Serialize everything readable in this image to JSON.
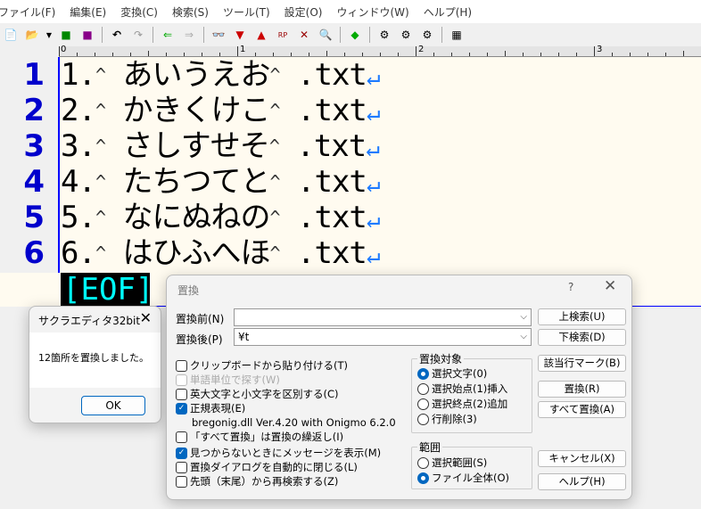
{
  "menu": [
    "ファイル(F)",
    "編集(E)",
    "変換(C)",
    "検索(S)",
    "ツール(T)",
    "設定(O)",
    "ウィンドウ(W)",
    "ヘルプ(H)"
  ],
  "ruler": [
    "0",
    "1",
    "2",
    "3"
  ],
  "editor": {
    "line_numbers": [
      "1",
      "2",
      "3",
      "4",
      "5",
      "6"
    ],
    "lines": [
      {
        "num": "1.",
        "kana": "あいうえお",
        "ext": ".txt"
      },
      {
        "num": "2.",
        "kana": "かきくけこ",
        "ext": ".txt"
      },
      {
        "num": "3.",
        "kana": "さしすせそ",
        "ext": ".txt"
      },
      {
        "num": "4.",
        "kana": "たちつてと",
        "ext": ".txt"
      },
      {
        "num": "5.",
        "kana": "なにぬねの",
        "ext": ".txt"
      },
      {
        "num": "6.",
        "kana": "はひふへほ",
        "ext": ".txt"
      }
    ],
    "caret_mark": "^",
    "return_mark": "↵",
    "eof": "[EOF]"
  },
  "msgbox": {
    "title": "サクラエディタ32bit",
    "message": "12箇所を置換しました。",
    "ok": "OK"
  },
  "replace": {
    "title": "置換",
    "help_q": "?",
    "before_label": "置換前(N)",
    "before_value": "",
    "after_label": "置換後(P)",
    "after_value": "¥t",
    "options": [
      {
        "label": "クリップボードから貼り付ける(T)",
        "checked": false,
        "disabled": false
      },
      {
        "label": "単語単位で探す(W)",
        "checked": false,
        "disabled": true
      },
      {
        "label": "英大文字と小文字を区別する(C)",
        "checked": false,
        "disabled": false
      },
      {
        "label": "正規表現(E)",
        "checked": true,
        "disabled": false
      },
      {
        "label": "「すべて置換」は置換の繰返し(I)",
        "checked": false,
        "disabled": false
      },
      {
        "label": "見つからないときにメッセージを表示(M)",
        "checked": true,
        "disabled": false
      },
      {
        "label": "置換ダイアログを自動的に閉じる(L)",
        "checked": false,
        "disabled": false
      },
      {
        "label": "先頭（末尾）から再検索する(Z)",
        "checked": false,
        "disabled": false
      }
    ],
    "regex_info": "bregonig.dll Ver.4.20 with Onigmo 6.2.0",
    "target_group": {
      "title": "置換対象",
      "options": [
        "選択文字(0)",
        "選択始点(1)挿入",
        "選択終点(2)追加",
        "行削除(3)"
      ],
      "selected": 0
    },
    "range_group": {
      "title": "範囲",
      "options": [
        "選択範囲(S)",
        "ファイル全体(O)"
      ],
      "selected": 1
    },
    "buttons": [
      "上検索(U)",
      "下検索(D)",
      "該当行マーク(B)",
      "置換(R)",
      "すべて置換(A)",
      "キャンセル(X)",
      "ヘルプ(H)"
    ]
  }
}
